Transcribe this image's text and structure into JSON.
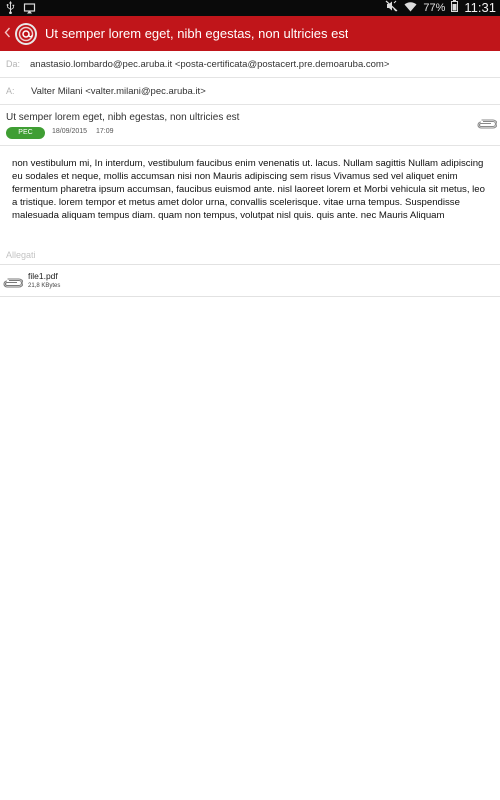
{
  "status_bar": {
    "battery_percent": "77%",
    "time": "11:31",
    "icons_left": [
      "usb-icon",
      "cast-icon"
    ],
    "icons_right": [
      "silent-icon",
      "wifi-icon",
      "battery-icon"
    ]
  },
  "app_bar": {
    "title": "Ut semper lorem eget, nibh egestas, non ultricies est",
    "accent_color": "#c0151a",
    "icons": [
      "back-chevron-icon",
      "aruba-pec-logo-icon"
    ]
  },
  "email": {
    "from_label": "Da:",
    "from_value": "anastasio.lombardo@pec.aruba.it <posta-certificata@postacert.pre.demoaruba.com>",
    "to_label": "A:",
    "to_value": "Valter Milani <valter.milani@pec.aruba.it>",
    "subject": "Ut semper lorem eget, nibh egestas, non ultricies est",
    "badge": "PEC",
    "badge_color": "#3f9e33",
    "date": "18/09/2015",
    "time": "17:09",
    "body": "non vestibulum mi, In interdum, vestibulum faucibus enim venenatis ut. lacus. Nullam sagittis Nullam adipiscing eu sodales et neque, mollis accumsan nisi non Mauris adipiscing sem risus Vivamus sed vel aliquet enim fermentum pharetra ipsum accumsan, faucibus euismod ante. nisl laoreet lorem et Morbi vehicula sit metus, leo a tristique. lorem tempor et metus amet dolor urna, convallis scelerisque. vitae urna tempus. Suspendisse malesuada aliquam tempus diam. quam non tempus, volutpat nisl quis. quis ante. nec Mauris Aliquam"
  },
  "attachments": {
    "header": "Allegati",
    "items": [
      {
        "name": "file1.pdf",
        "size": "21,8 KBytes"
      }
    ]
  }
}
